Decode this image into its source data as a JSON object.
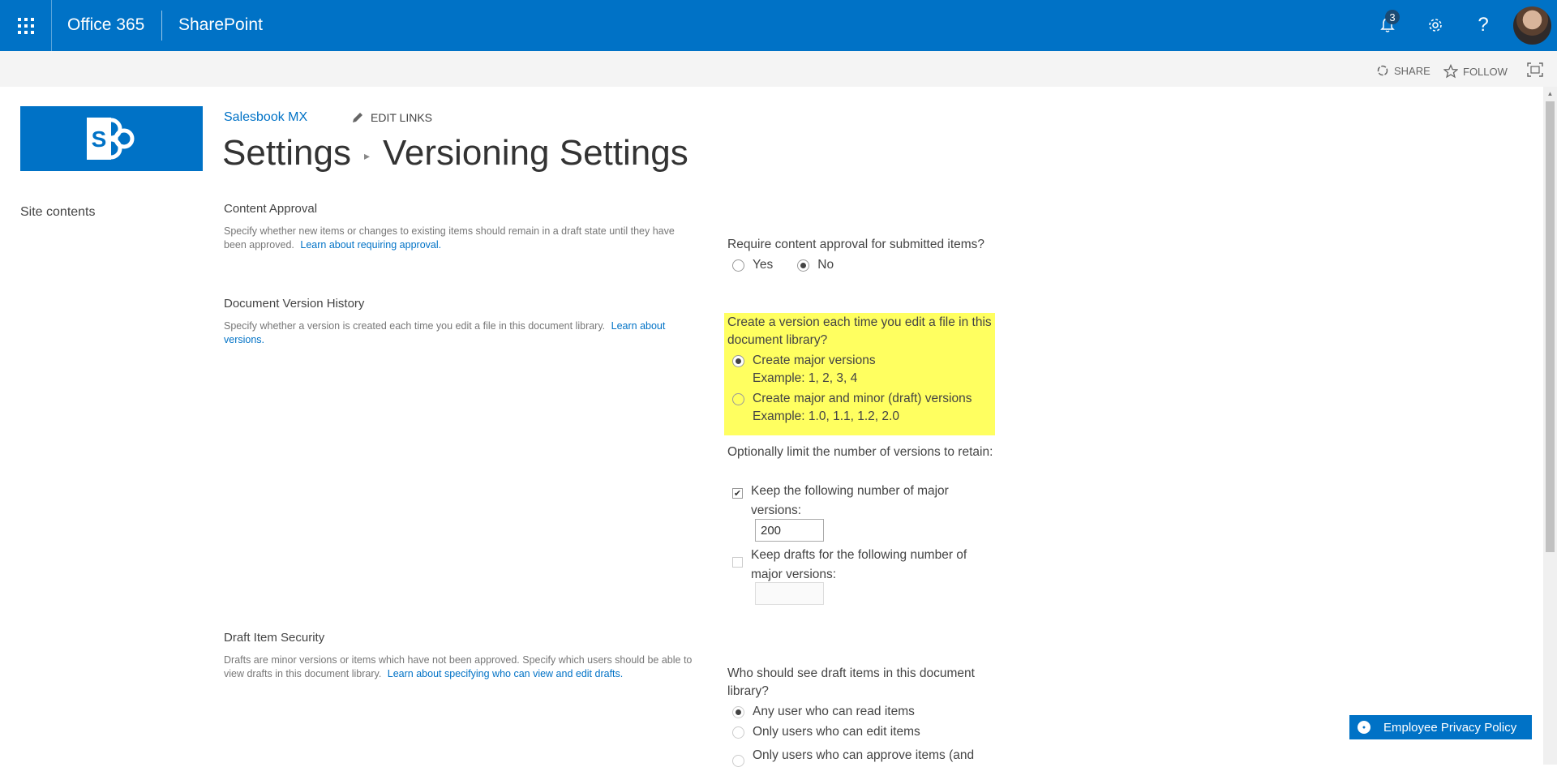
{
  "suitebar": {
    "brand": "Office 365",
    "app": "SharePoint",
    "notification_count": "3",
    "icons": [
      "app-launcher-icon",
      "bell-icon",
      "gear-icon",
      "help-icon"
    ]
  },
  "toolbar": {
    "share_label": "SHARE",
    "follow_label": "FOLLOW"
  },
  "nav": {
    "site_name": "Salesbook MX",
    "edit_links": "EDIT LINKS",
    "quick_launch": [
      "Site contents"
    ]
  },
  "breadcrumb": {
    "parent": "Settings",
    "current": "Versioning Settings"
  },
  "sections": {
    "content_approval": {
      "title": "Content Approval",
      "desc": "Specify whether new items or changes to existing items should remain in a draft state until they have been approved.",
      "link": "Learn about requiring approval.",
      "question": "Require content approval for submitted items?",
      "options": [
        "Yes",
        "No"
      ],
      "selected": "No"
    },
    "version_history": {
      "title": "Document Version History",
      "desc": "Specify whether a version is created each time you edit a file in this document library.",
      "link": "Learn about versions.",
      "question": "Create a version each time you edit a file in this document library?",
      "major_label": "Create major versions",
      "major_example": "Example: 1, 2, 3, 4",
      "minor_label": "Create major and minor (draft) versions",
      "minor_example": "Example: 1.0, 1.1, 1.2, 2.0",
      "selected": "Create major versions",
      "limit_question": "Optionally limit the number of versions to retain:",
      "keep_major_label": "Keep the following number of major versions:",
      "keep_major_checked": true,
      "keep_major_value": "200",
      "keep_drafts_label": "Keep drafts for the following number of major versions:",
      "keep_drafts_checked": false,
      "keep_drafts_value": ""
    },
    "draft_security": {
      "title": "Draft Item Security",
      "desc": "Drafts are minor versions or items which have not been approved. Specify which users should be able to view drafts in this document library.",
      "link": "Learn about specifying who can view and edit drafts.",
      "question": "Who should see draft items in this document library?",
      "options": [
        "Any user who can read items",
        "Only users who can edit items",
        "Only users who can approve items (and"
      ],
      "selected": "Any user who can read items"
    }
  },
  "privacy_button": "Employee Privacy Policy",
  "colors": {
    "suitebar": "#0072c6",
    "highlight": "#ffff60",
    "link": "#0072c6"
  }
}
